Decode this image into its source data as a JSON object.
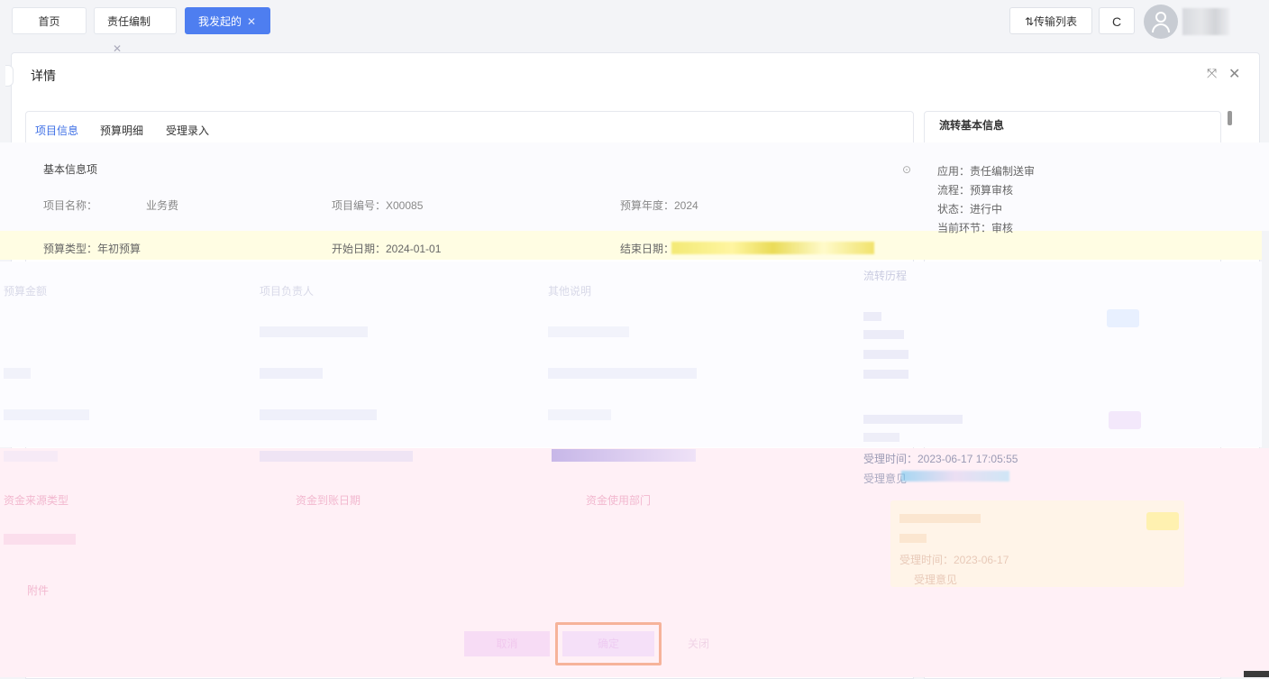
{
  "tabs": [
    {
      "label": "首页",
      "closable": false,
      "active": false
    },
    {
      "label": "责任编制",
      "closable": true,
      "active": false
    },
    {
      "label": "我发起的",
      "closable": true,
      "active": true
    }
  ],
  "toolbar": {
    "transfer_label": "传输列表",
    "transfer_icon": "⇅",
    "refresh_label": "C"
  },
  "dialog": {
    "title": "详情",
    "inner_tabs": [
      "项目信息",
      "预算明细",
      "受理录入"
    ],
    "section_title": "基本信息项",
    "fields": {
      "project_name_label": "项目名称：",
      "project_name_value": "业务费",
      "project_code": "项目编号：X00085",
      "budget_year": "预算年度：2024",
      "budget_type": "预算类型：年初预算",
      "start_date": "开始日期：2024-01-01",
      "end_date_label": "结束日期："
    },
    "faint_rows": [
      "预算金额",
      "项目负责人",
      "其他说明"
    ],
    "pink_rows": [
      "资金来源类型",
      "资金到账日期",
      "资金使用部门"
    ],
    "pink_extra": "附件"
  },
  "flow": {
    "panel_title": "流转基本信息",
    "form_label": "应用：",
    "form_value": "责任编制送审",
    "process_label": "流程：",
    "process_value": "预算审核",
    "status_label": "状态：",
    "status_value": "进行中",
    "node_label": "当前环节：",
    "node_value": "审核",
    "history_title": "流转历程",
    "record_time": "受理时间：2023-06-17 17:05:55",
    "record_time_label": "受理时间",
    "record_opinion": "受理意见",
    "record_time2": "受理时间：2023-06-17",
    "record_opinion2": "受理意见"
  },
  "footer": {
    "cancel": "取消",
    "confirm": "确定",
    "close": "关闭"
  }
}
